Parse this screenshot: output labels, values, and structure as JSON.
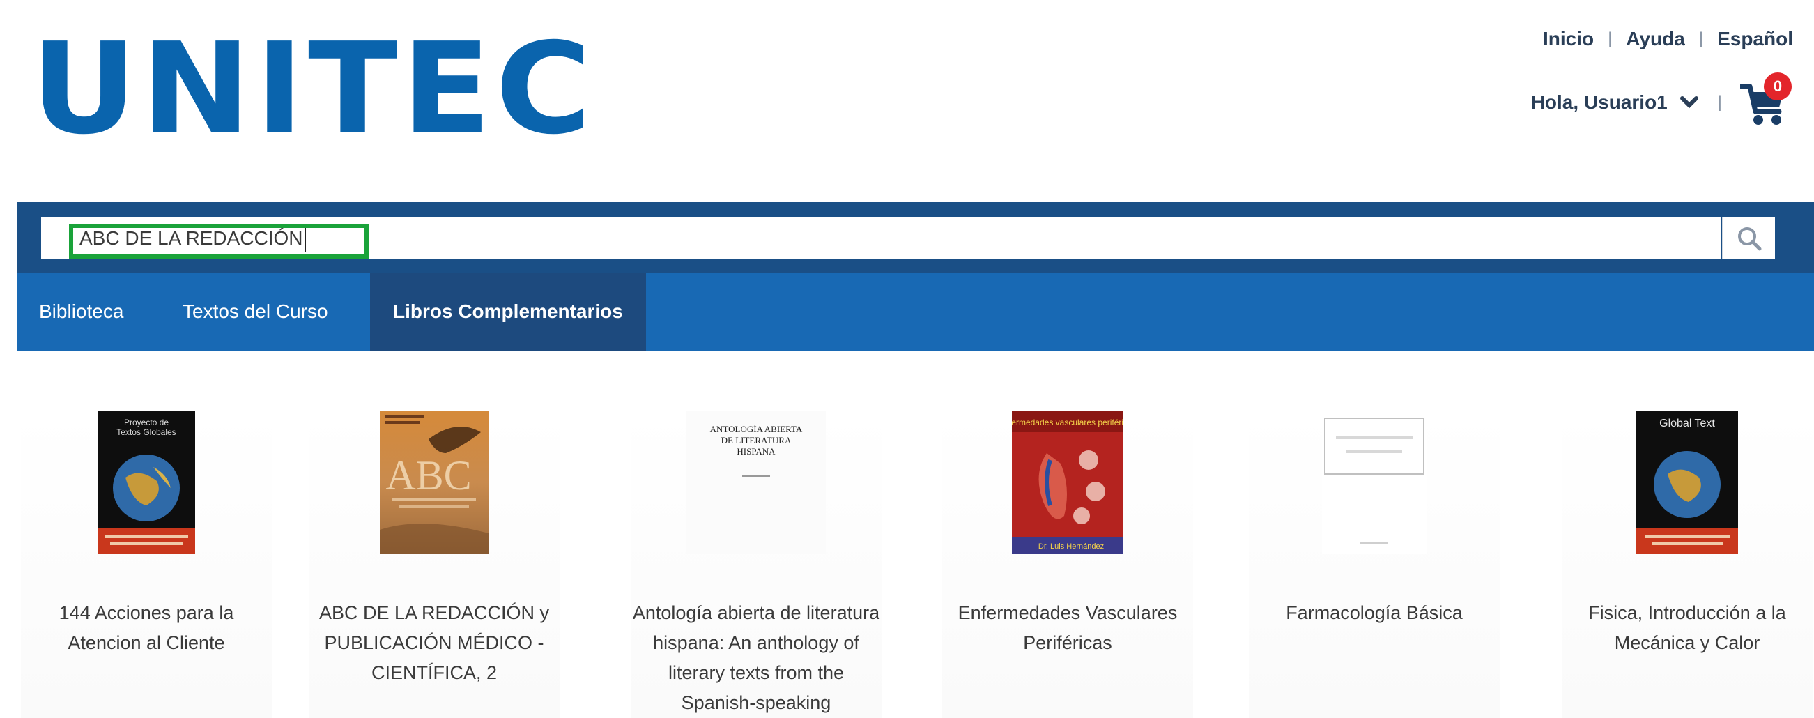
{
  "header": {
    "logo_text": "UNITEC",
    "links": {
      "home": "Inicio",
      "help": "Ayuda",
      "language": "Español",
      "separator": "|"
    },
    "user_greeting": "Hola, Usuario1",
    "cart_count": "0"
  },
  "search": {
    "value": "ABC DE LA REDACCIÓN",
    "button_icon": "search-icon"
  },
  "nav": {
    "tabs": [
      {
        "label": "Biblioteca",
        "active": false
      },
      {
        "label": "Textos del Curso",
        "active": false
      },
      {
        "label": "Libros Complementarios",
        "active": true
      }
    ]
  },
  "books": [
    {
      "title": "144 Acciones para la Atencion al Cliente",
      "cover_text": "Proyecto de Textos Globales"
    },
    {
      "title": "ABC DE LA REDACCIÓN y PUBLICACIÓN MÉDICO - CIENTÍFICA, 2",
      "cover_text": "ABC"
    },
    {
      "title": "Antología abierta de literatura hispana: An anthology of literary texts from the Spanish-speaking",
      "cover_text": "ANTOLOGÍA ABIERTA DE LITERATURA HISPANA"
    },
    {
      "title": "Enfermedades Vasculares Periféricas",
      "cover_text": "Enfermedades vasculares periféricas"
    },
    {
      "title": "Farmacología Básica",
      "cover_text": ""
    },
    {
      "title": "Fisica, Introducción a la Mecánica y Calor",
      "cover_text": "Global Text"
    }
  ],
  "colors": {
    "brand_blue": "#0a64ad",
    "search_bar": "#1a4f86",
    "nav_bar": "#1869b4",
    "nav_active": "#1d4a7e",
    "focus_outline": "#1aa33a",
    "badge_red": "#e3252b"
  }
}
